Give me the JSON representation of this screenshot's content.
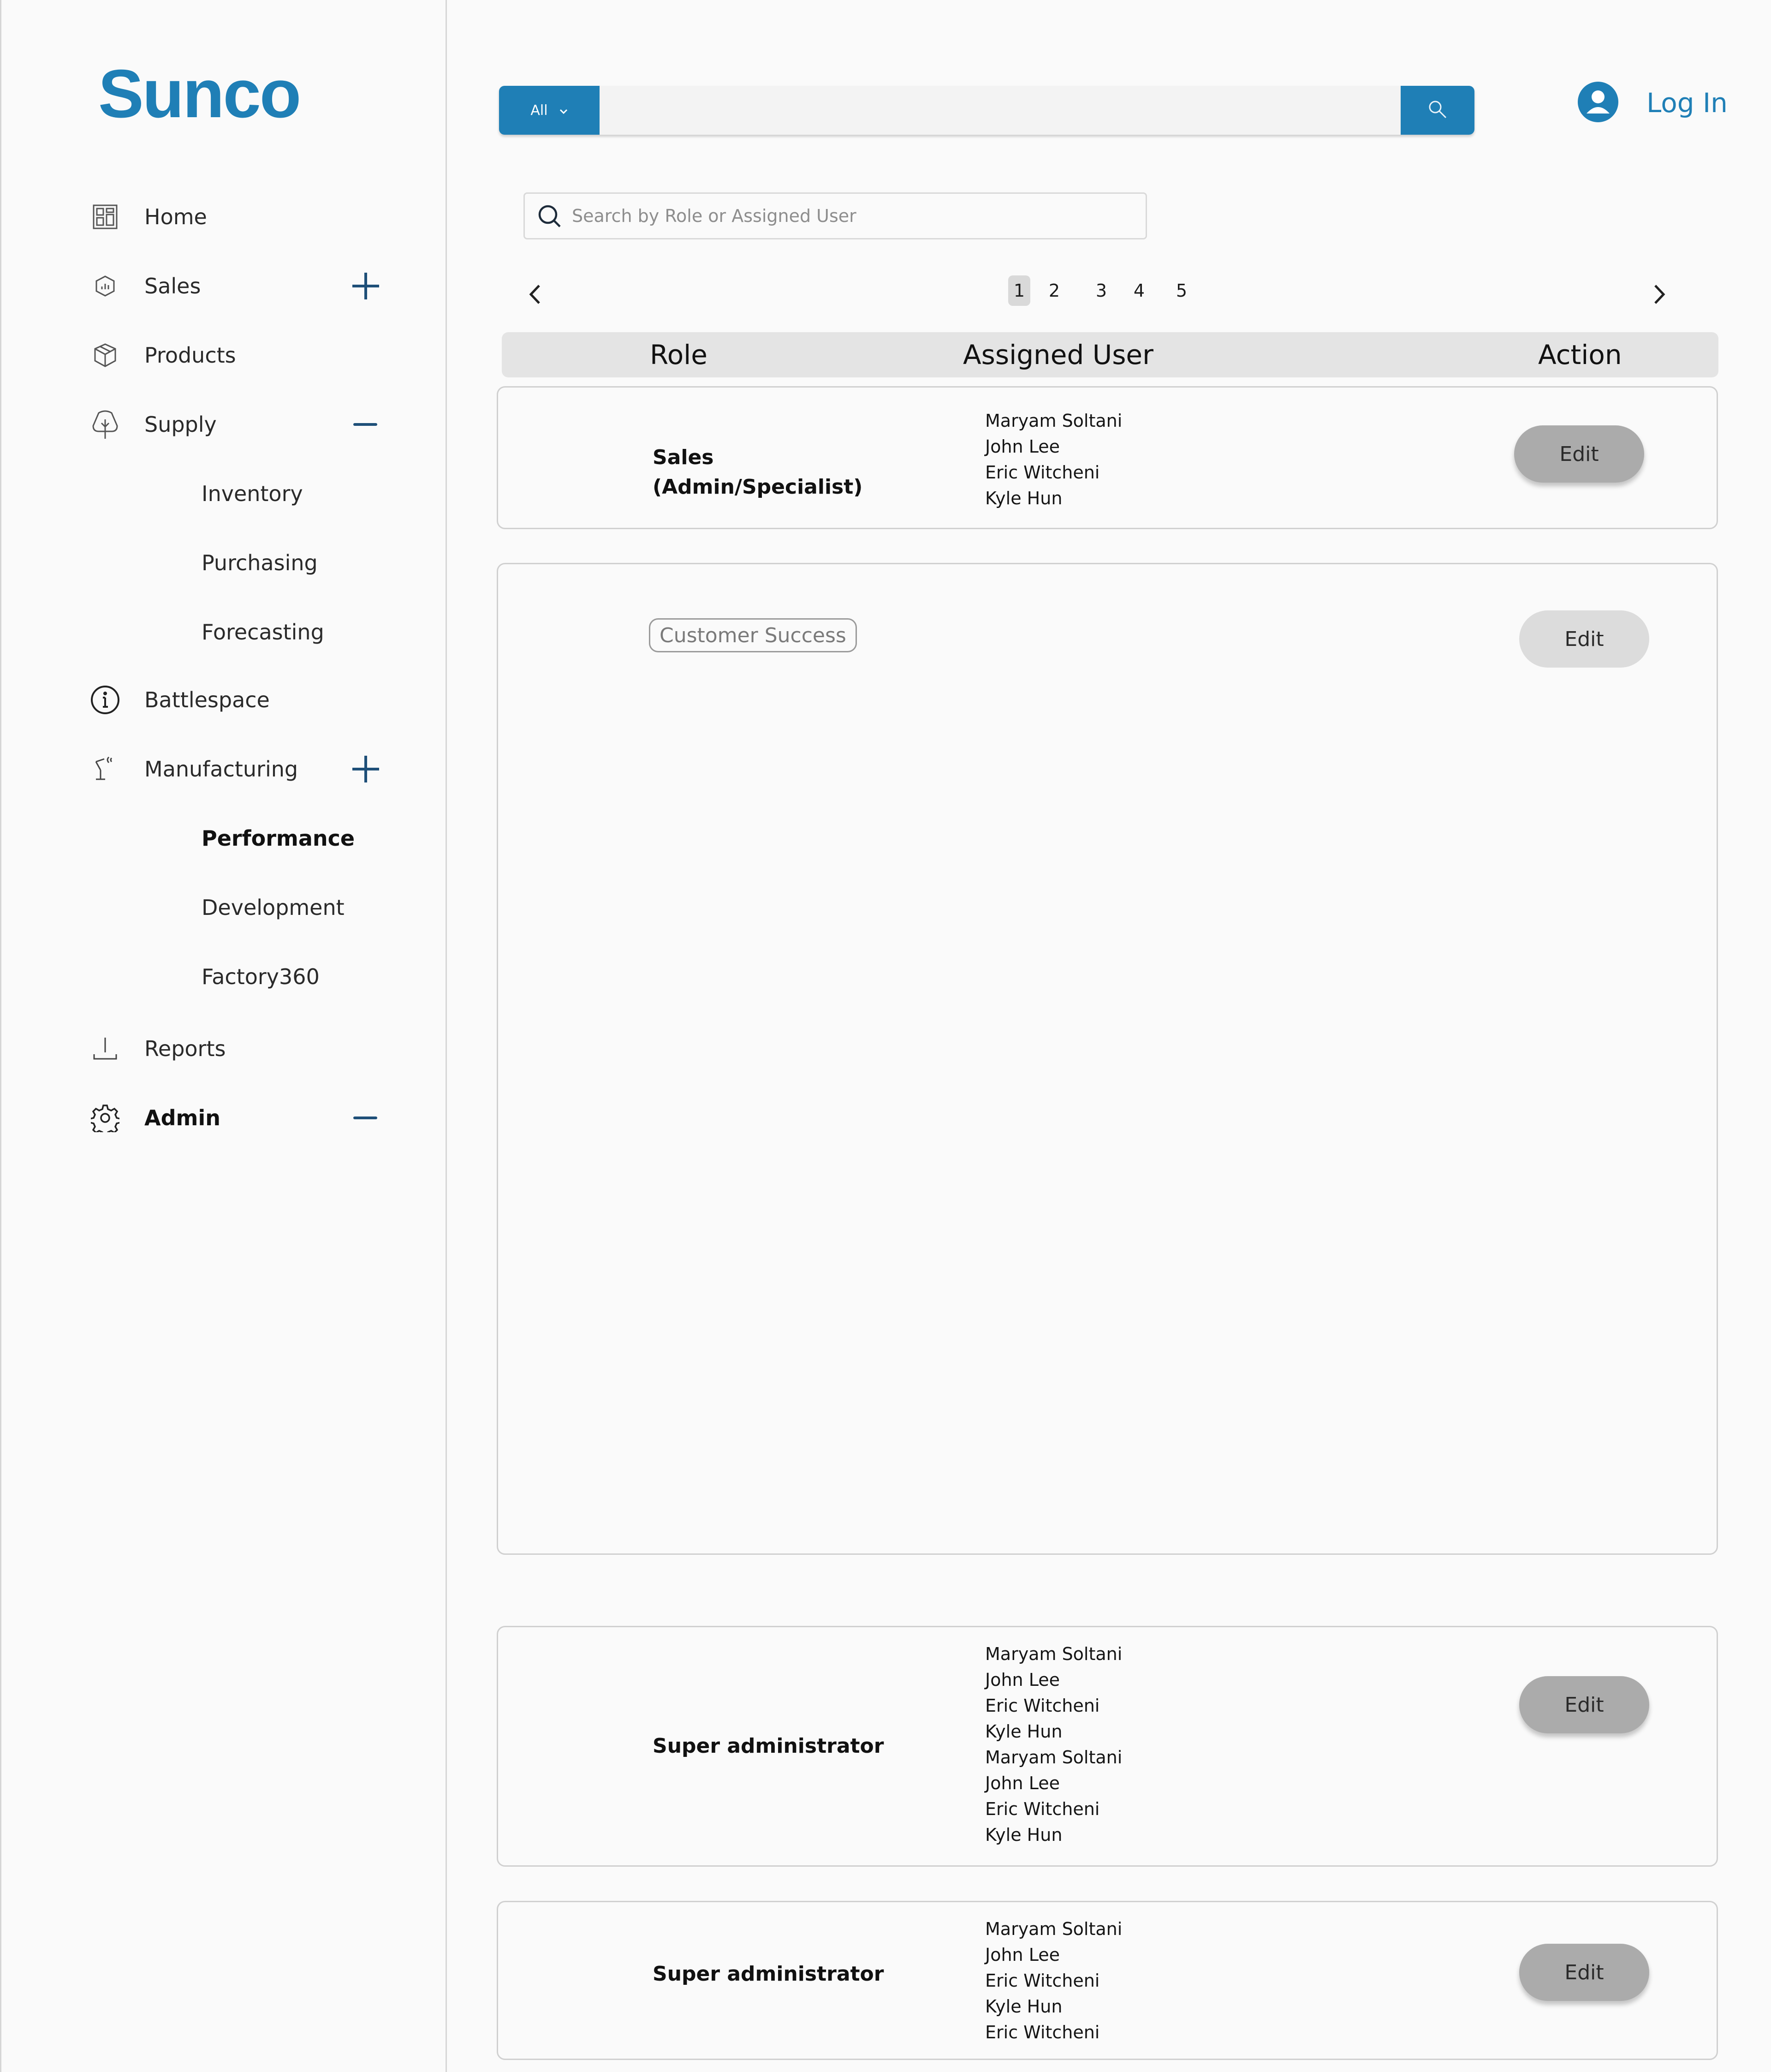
{
  "brand": {
    "logo_text": "Sunco",
    "accent": "#1f7fb6"
  },
  "sidebar": {
    "items": [
      {
        "label": "Home",
        "icon": "dashboard-icon"
      },
      {
        "label": "Sales",
        "icon": "hexagon-chart-icon",
        "toggle": "plus-icon"
      },
      {
        "label": "Products",
        "icon": "box-icon"
      },
      {
        "label": "Supply",
        "icon": "tree-icon",
        "toggle": "minus-icon"
      },
      {
        "label": "Battlespace",
        "icon": "info-icon"
      },
      {
        "label": "Manufacturing",
        "icon": "robot-arm-icon",
        "toggle": "plus-icon"
      },
      {
        "label": "Reports",
        "icon": "download-icon"
      },
      {
        "label": "Admin",
        "icon": "gear-icon",
        "toggle": "minus-icon"
      }
    ],
    "supply_sub": [
      "Inventory",
      "Purchasing",
      "Forecasting"
    ],
    "manufacturing_sub": [
      "Performance",
      "Development",
      "Factory360"
    ]
  },
  "topbar": {
    "scope_label": "All",
    "search_value": "",
    "login_label": "Log In"
  },
  "filter": {
    "placeholder": "Search by Role or Assigned User"
  },
  "pagination": {
    "pages": [
      "1",
      "2",
      "3",
      "4",
      "5"
    ],
    "current": "1"
  },
  "table": {
    "headers": {
      "role": "Role",
      "assigned": "Assigned User",
      "action": "Action"
    },
    "rows": [
      {
        "role_line1": "Sales",
        "role_line2": "(Admin/Specialist)",
        "users": [
          "Maryam Soltani",
          "John Lee",
          "Eric Witcheni",
          "Kyle Hun"
        ],
        "action": "Edit"
      },
      {
        "role": "Customer Success",
        "users": [],
        "action": "Edit"
      },
      {
        "role": "Super administrator",
        "users": [
          "Maryam Soltani",
          "John Lee",
          "Eric Witcheni",
          "Kyle Hun",
          "Maryam Soltani",
          "John Lee",
          "Eric Witcheni",
          "Kyle Hun"
        ],
        "action": "Edit"
      },
      {
        "role": "Super administrator",
        "users": [
          "Maryam Soltani",
          "John Lee",
          "Eric Witcheni",
          "Kyle Hun",
          "Eric Witcheni"
        ],
        "action": "Edit"
      }
    ]
  }
}
